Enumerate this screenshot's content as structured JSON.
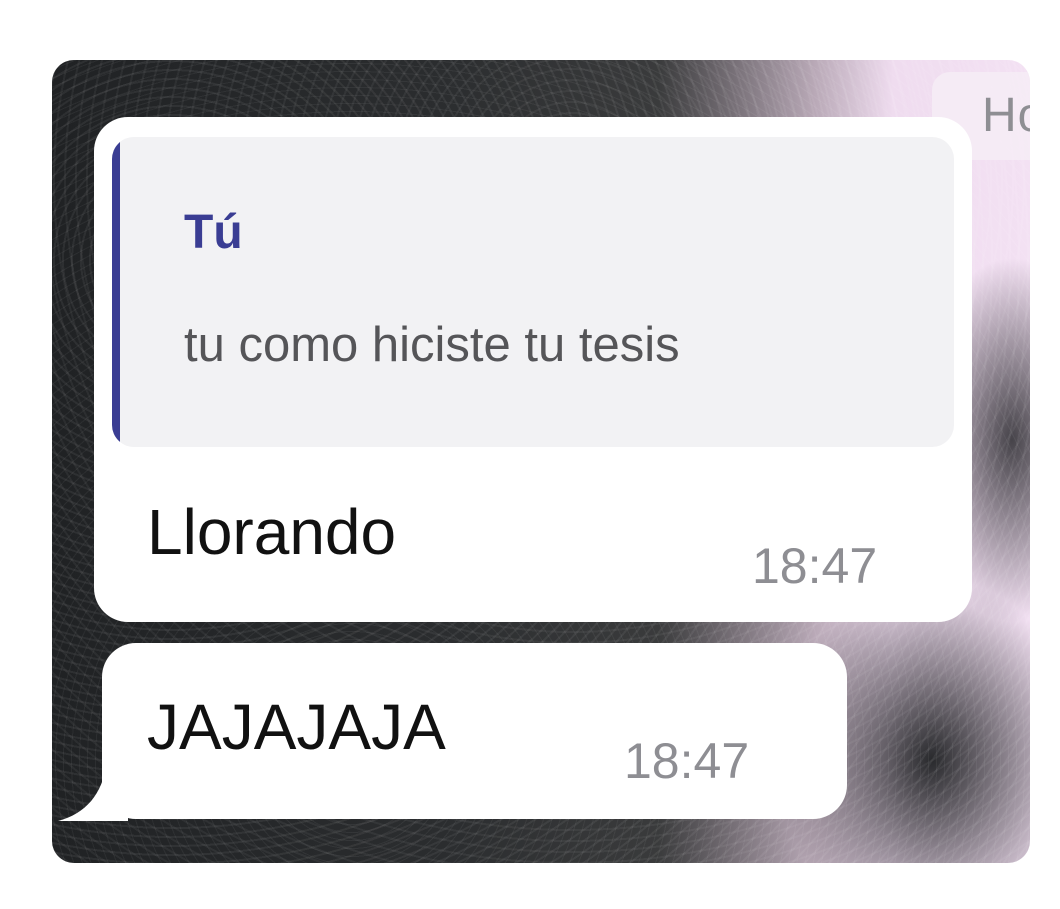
{
  "chat": {
    "date_label": "Hoy",
    "messages": [
      {
        "reply_to": {
          "author": "Tú",
          "text": "tu como hiciste tu tesis"
        },
        "text": "Llorando",
        "time": "18:47"
      },
      {
        "text": "JAJAJAJA",
        "time": "18:47"
      }
    ],
    "colors": {
      "quote_accent": "#3a3d93",
      "bubble": "#ffffff",
      "timestamp": "#8e8e93"
    }
  }
}
